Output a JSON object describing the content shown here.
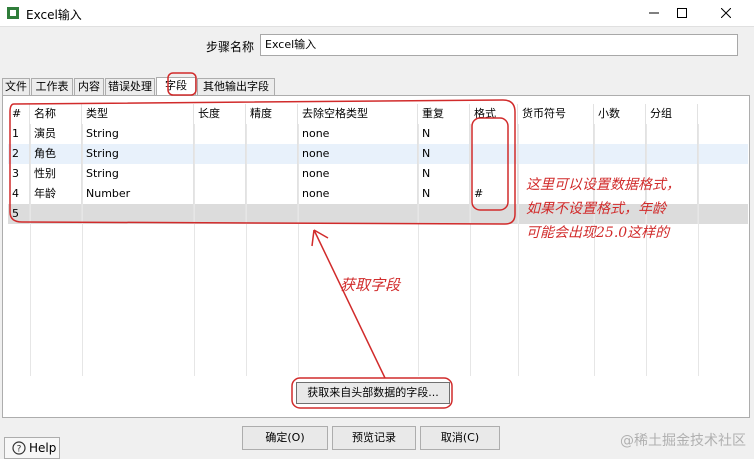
{
  "window": {
    "title": "Excel输入",
    "icon": "excel-app-icon",
    "controls": [
      "minimize-icon",
      "maximize-icon",
      "close-icon"
    ]
  },
  "step": {
    "label": "步骤名称",
    "value": "Excel输入"
  },
  "tabs": [
    {
      "label": "文件",
      "active": false
    },
    {
      "label": "工作表",
      "active": false
    },
    {
      "label": "内容",
      "active": false
    },
    {
      "label": "错误处理",
      "active": false
    },
    {
      "label": "字段",
      "active": true
    },
    {
      "label": "其他输出字段",
      "active": false
    }
  ],
  "grid": {
    "columns": [
      "#",
      "名称",
      "类型",
      "长度",
      "精度",
      "去除空格类型",
      "重复",
      "格式",
      "货币符号",
      "小数",
      "分组"
    ],
    "rows": [
      [
        "1",
        "演员",
        "String",
        "",
        "",
        "none",
        "N",
        "",
        "",
        "",
        ""
      ],
      [
        "2",
        "角色",
        "String",
        "",
        "",
        "none",
        "N",
        "",
        "",
        "",
        ""
      ],
      [
        "3",
        "性别",
        "String",
        "",
        "",
        "none",
        "N",
        "",
        "",
        "",
        ""
      ],
      [
        "4",
        "年龄",
        "Number",
        "",
        "",
        "none",
        "N",
        "#",
        "",
        "",
        ""
      ],
      [
        "5",
        "",
        "",
        "",
        "",
        "",
        "",
        "",
        "",
        "",
        ""
      ]
    ]
  },
  "get_fields_button": "获取来自头部数据的字段...",
  "buttons": {
    "ok": "确定(O)",
    "preview": "预览记录",
    "cancel": "取消(C)",
    "help": "Help"
  },
  "annotations": {
    "format_note_1": "这里可以设置数据格式，",
    "format_note_2": "如果不设置格式，年龄",
    "format_note_3": "可能会出现25.0这样的",
    "get_fields_note": "获取字段",
    "color": "#d12b2b"
  },
  "watermark": "@稀土掘金技术社区"
}
